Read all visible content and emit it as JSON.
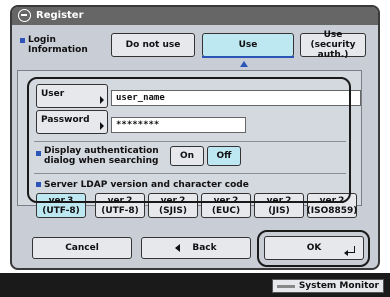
{
  "window": {
    "title": "Register",
    "icon": "register-icon"
  },
  "login": {
    "label_line1": "Login",
    "label_line2": "Information",
    "options": [
      "Do not use",
      "Use"
    ],
    "option3_line1": "Use (security",
    "option3_line2": "auth.)",
    "selected": "Use"
  },
  "credentials": {
    "user_label": "User",
    "user_value": "user_name",
    "password_label": "Password",
    "password_value": "********"
  },
  "auth_dialog": {
    "label_line1": "Display authentication",
    "label_line2": "dialog when searching",
    "on_label": "On",
    "off_label": "Off",
    "selected": "Off"
  },
  "ldap": {
    "label": "Server LDAP version and character code",
    "options": [
      {
        "line1": "ver.3",
        "line2": "(UTF-8)",
        "selected": true
      },
      {
        "line1": "ver.2",
        "line2": "(UTF-8)",
        "selected": false
      },
      {
        "line1": "ver.2",
        "line2": "(SJIS)",
        "selected": false
      },
      {
        "line1": "ver.2",
        "line2": "(EUC)",
        "selected": false
      },
      {
        "line1": "ver.2",
        "line2": "(JIS)",
        "selected": false
      },
      {
        "line1": "ver.2",
        "line2": "(ISO8859)",
        "selected": false
      }
    ]
  },
  "footer": {
    "cancel": "Cancel",
    "back": "Back",
    "ok": "OK"
  },
  "status": {
    "system_monitor": "System Monitor"
  },
  "colors": {
    "accent": "#2c55b8",
    "selected": "#bde8f2",
    "panel": "#c8cdd6"
  }
}
